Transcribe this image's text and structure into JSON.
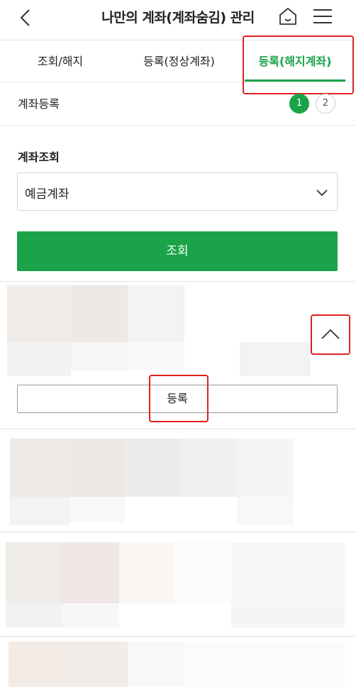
{
  "header": {
    "title": "나만의 계좌(계좌숨김) 관리",
    "back_icon": "back-chevron-icon",
    "home_icon": "home-icon",
    "menu_icon": "hamburger-menu-icon"
  },
  "tabs": [
    {
      "label": "조회/해지",
      "active": false
    },
    {
      "label": "등록(정상계좌)",
      "active": false
    },
    {
      "label": "등록(해지계좌)",
      "active": true
    }
  ],
  "steps": {
    "title": "계좌등록",
    "current": "1",
    "next": "2"
  },
  "query": {
    "label": "계좌조회",
    "select_value": "예금계좌",
    "button_label": "조회"
  },
  "account_card": {
    "register_label": "등록"
  },
  "colors": {
    "accent": "#1ba34a",
    "highlight": "#e02020"
  }
}
